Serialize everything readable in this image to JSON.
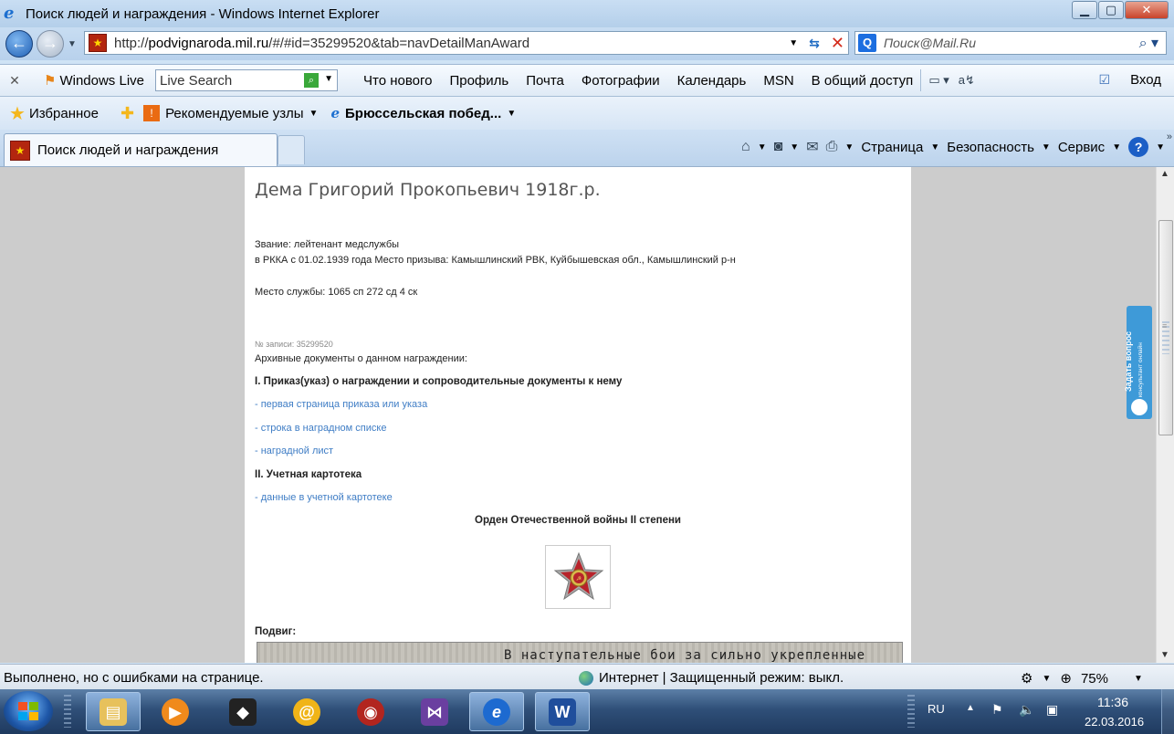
{
  "window": {
    "title": "Поиск людей и награждения - Windows Internet Explorer",
    "buttons": {
      "minimize": "▁",
      "maximize": "▢",
      "close": "✕"
    }
  },
  "address": {
    "url_prefix": "http://",
    "url_host": "podvignaroda.mil.ru",
    "url_path": "/#/#id=35299520&tab=navDetailManAward",
    "search_placeholder": "Поиск@Mail.Ru"
  },
  "live_toolbar": {
    "brand": "Windows Live",
    "search_placeholder": "Live Search",
    "links": [
      "Что нового",
      "Профиль",
      "Почта",
      "Фотографии",
      "Календарь",
      "MSN",
      "В общий доступ"
    ],
    "signin": "Вход"
  },
  "favorites_bar": {
    "favorites": "Избранное",
    "suggested": "Рекомендуемые узлы",
    "item": "Брюссельская побед..."
  },
  "tabs": [
    {
      "label": "Поиск людей и награждения"
    }
  ],
  "command_bar": {
    "page": "Страница",
    "safety": "Безопасность",
    "tools": "Сервис"
  },
  "content": {
    "person_name": "Дема Григорий Прокопьевич 1918г.р.",
    "rank": "Звание: лейтенант медслужбы",
    "service": "в РККА с 01.02.1939 года Место призыва: Камышлинский РВК, Куйбышевская обл., Камышлинский р-н",
    "unit": "Место службы: 1065 сп 272 сд 4 ск",
    "record_no": "№ записи: 35299520",
    "archive_docs": "Архивные документы о данном награждении:",
    "section1": "I. Приказ(указ) о награждении и сопроводительные документы к нему",
    "link1": "- первая страница приказа или указа",
    "link2": "- строка в наградном списке",
    "link3": "- наградной лист",
    "section2": "II. Учетная картотека",
    "link4": "- данные в учетной картотеке",
    "award_title": "Орден Отечественной войны II степени",
    "feat_label": "Подвиг:",
    "scan_text": "В наступательные бои за сильно укрепленные опор-"
  },
  "ask_widget": {
    "title": "Задать вопрос",
    "subtitle": "консультант онлайн"
  },
  "statusbar": {
    "message": "Выполнено, но с ошибками на странице.",
    "zone": "Интернет | Защищенный режим: выкл.",
    "zoom": "75%"
  },
  "taskbar": {
    "lang": "RU",
    "time": "11:36",
    "date": "22.03.2016"
  },
  "colors": {
    "link": "#3f7dc5",
    "accent_blue": "#3e9ad8",
    "taskbar": "#2f4f78"
  }
}
